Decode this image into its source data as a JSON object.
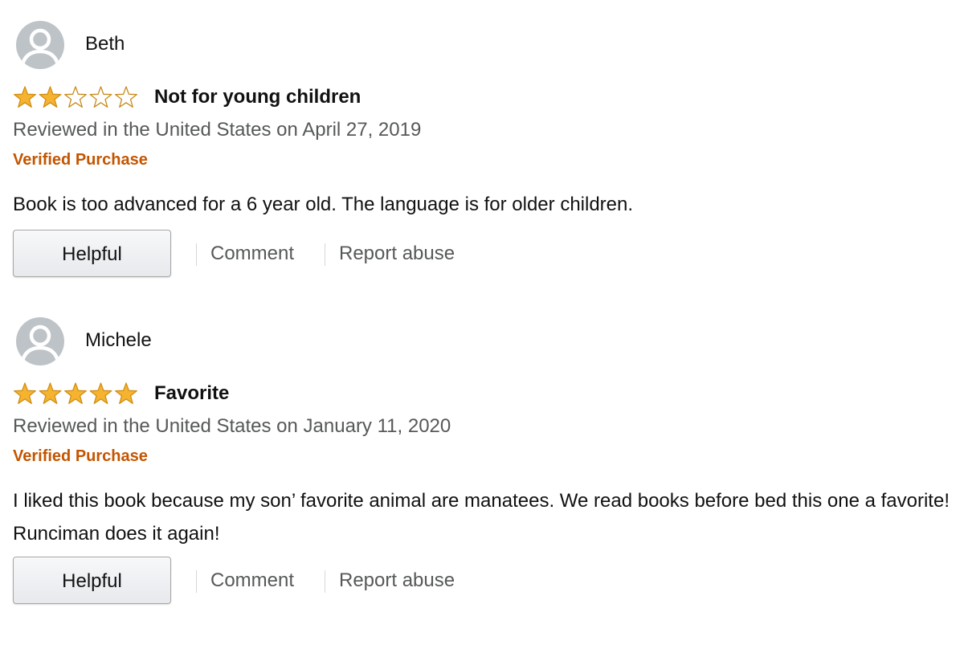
{
  "reviews": [
    {
      "reviewer": "Beth",
      "avatar_icon": "default-profile-avatar",
      "rating": 2,
      "rating_max": 5,
      "title": "Not for young children",
      "date_line": "Reviewed in the United States on April 27, 2019",
      "verified_label": "Verified Purchase",
      "body": "Book is too advanced for a 6 year old. The language is for older children.",
      "helpful_label": "Helpful",
      "comment_label": "Comment",
      "report_label": "Report abuse"
    },
    {
      "reviewer": "Michele",
      "avatar_icon": "default-profile-avatar",
      "rating": 5,
      "rating_max": 5,
      "title": "Favorite",
      "date_line": "Reviewed in the United States on January 11, 2020",
      "verified_label": "Verified Purchase",
      "body": "I liked this book because my son’ favorite animal are manatees. We read books before bed this one a favorite! Runciman does it again!",
      "helpful_label": "Helpful",
      "comment_label": "Comment",
      "report_label": "Report abuse"
    }
  ],
  "colors": {
    "star_fill": "#f5b330",
    "star_stroke": "#d18e14",
    "star_empty_stroke": "#c88a1a",
    "verified": "#c45500",
    "meta_text": "#565959",
    "avatar_bg": "#bdc3c7"
  }
}
